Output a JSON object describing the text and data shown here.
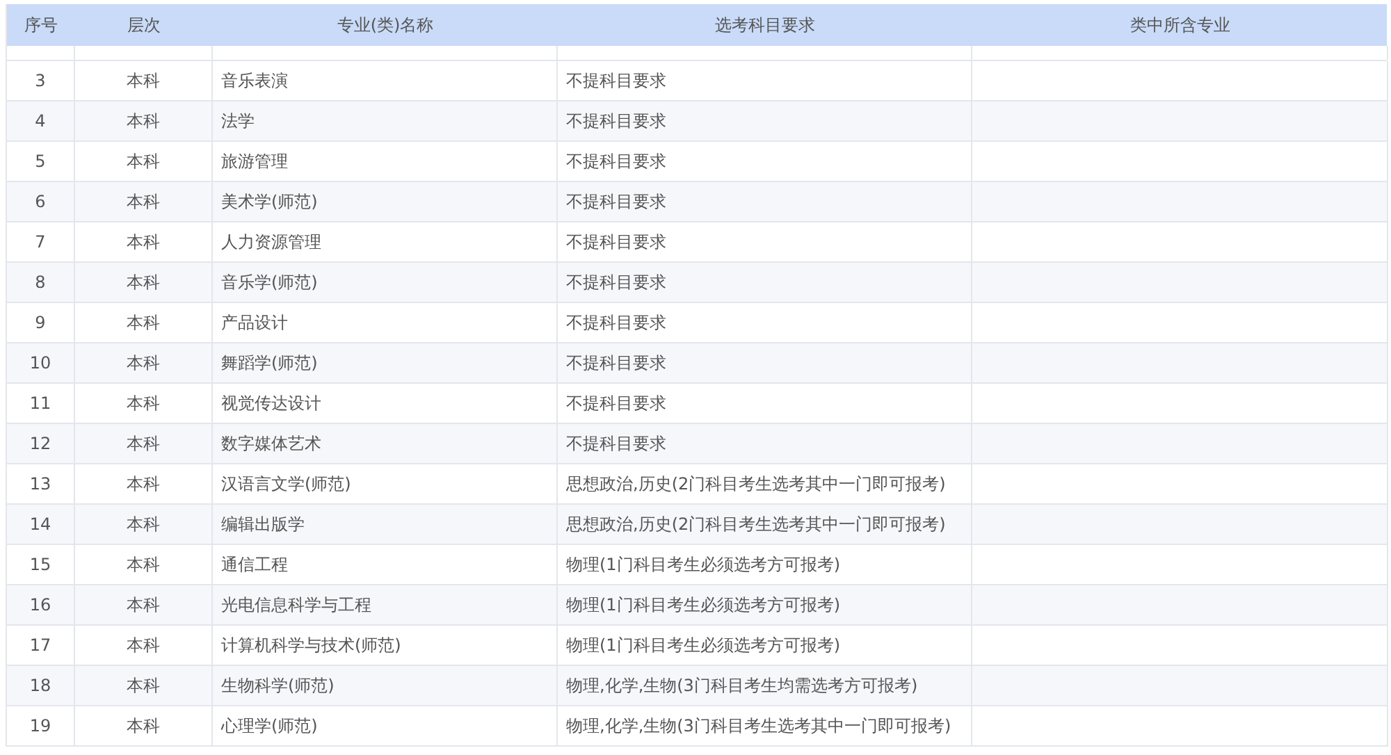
{
  "table": {
    "columns": [
      "序号",
      "层次",
      "专业(类)名称",
      "选考科目要求",
      "类中所含专业"
    ],
    "rows": [
      {
        "no": "3",
        "level": "本科",
        "major": "音乐表演",
        "requirement": "不提科目要求"
      },
      {
        "no": "4",
        "level": "本科",
        "major": "法学",
        "requirement": "不提科目要求"
      },
      {
        "no": "5",
        "level": "本科",
        "major": "旅游管理",
        "requirement": "不提科目要求"
      },
      {
        "no": "6",
        "level": "本科",
        "major": "美术学(师范)",
        "requirement": "不提科目要求"
      },
      {
        "no": "7",
        "level": "本科",
        "major": "人力资源管理",
        "requirement": "不提科目要求"
      },
      {
        "no": "8",
        "level": "本科",
        "major": "音乐学(师范)",
        "requirement": "不提科目要求"
      },
      {
        "no": "9",
        "level": "本科",
        "major": "产品设计",
        "requirement": "不提科目要求"
      },
      {
        "no": "10",
        "level": "本科",
        "major": "舞蹈学(师范)",
        "requirement": "不提科目要求"
      },
      {
        "no": "11",
        "level": "本科",
        "major": "视觉传达设计",
        "requirement": "不提科目要求"
      },
      {
        "no": "12",
        "level": "本科",
        "major": "数字媒体艺术",
        "requirement": "不提科目要求"
      },
      {
        "no": "13",
        "level": "本科",
        "major": "汉语言文学(师范)",
        "requirement": "思想政治,历史(2门科目考生选考其中一门即可报考)"
      },
      {
        "no": "14",
        "level": "本科",
        "major": "编辑出版学",
        "requirement": "思想政治,历史(2门科目考生选考其中一门即可报考)"
      },
      {
        "no": "15",
        "level": "本科",
        "major": "通信工程",
        "requirement": "物理(1门科目考生必须选考方可报考)"
      },
      {
        "no": "16",
        "level": "本科",
        "major": "光电信息科学与工程",
        "requirement": "物理(1门科目考生必须选考方可报考)"
      },
      {
        "no": "17",
        "level": "本科",
        "major": "计算机科学与技术(师范)",
        "requirement": "物理(1门科目考生必须选考方可报考)"
      },
      {
        "no": "18",
        "level": "本科",
        "major": "生物科学(师范)",
        "requirement": "物理,化学,生物(3门科目考生均需选考方可报考)"
      },
      {
        "no": "19",
        "level": "本科",
        "major": "心理学(师范)",
        "requirement": "物理,化学,生物(3门科目考生选考其中一门即可报考)"
      }
    ]
  }
}
